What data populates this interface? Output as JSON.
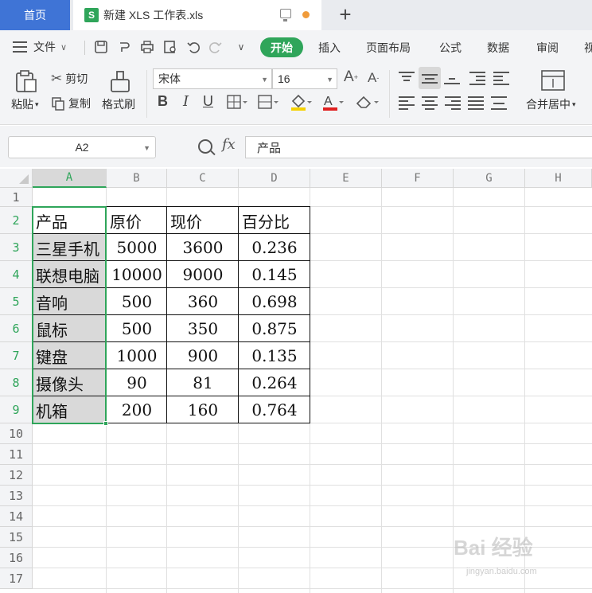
{
  "tabs": {
    "home": "首页",
    "file": "新建 XLS 工作表.xls",
    "file_icon": "S",
    "new_tab": "+"
  },
  "menu": {
    "file": "文件",
    "tabs": [
      "开始",
      "插入",
      "页面布局",
      "公式",
      "数据",
      "审阅",
      "视"
    ]
  },
  "ribbon": {
    "paste": "粘贴",
    "cut": "剪切",
    "copy": "复制",
    "format_painter": "格式刷",
    "font_name": "宋体",
    "font_size": "16",
    "bold": "B",
    "italic": "I",
    "underline": "U",
    "merge_center": "合并居中"
  },
  "formula_bar": {
    "name_box": "A2",
    "fx": "fx",
    "content": "产品"
  },
  "sheet": {
    "columns": [
      "A",
      "B",
      "C",
      "D",
      "E",
      "F",
      "G",
      "H"
    ],
    "rows": [
      "1",
      "2",
      "3",
      "4",
      "5",
      "6",
      "7",
      "8",
      "9",
      "10",
      "11",
      "12",
      "13",
      "14",
      "15",
      "16",
      "17"
    ],
    "header": [
      "产品",
      "原价",
      "现价",
      "百分比"
    ],
    "data": [
      [
        "三星手机",
        "5000",
        "3600",
        "0.236"
      ],
      [
        "联想电脑",
        "10000",
        "9000",
        "0.145"
      ],
      [
        "音响",
        "500",
        "360",
        "0.698"
      ],
      [
        "鼠标",
        "500",
        "350",
        "0.875"
      ],
      [
        "键盘",
        "1000",
        "900",
        "0.135"
      ],
      [
        "摄像头",
        "90",
        "81",
        "0.264"
      ],
      [
        "机箱",
        "200",
        "160",
        "0.764"
      ]
    ]
  },
  "watermark": {
    "text": "Bai 经验",
    "sub": "jingyan.baidu.com"
  },
  "colors": {
    "accent_green": "#2fa55a",
    "home_tab_blue": "#3f74d6",
    "selection_fill": "#d9d9d9"
  }
}
